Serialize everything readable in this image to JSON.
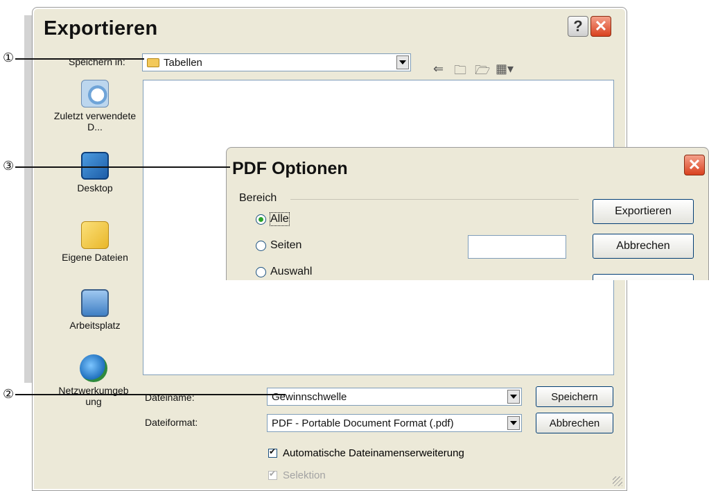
{
  "callouts": [
    "①",
    "②",
    "③"
  ],
  "export_dialog": {
    "title": "Exportieren",
    "help_glyph": "?",
    "close_glyph": "✕",
    "save_in_label": "Speichern in:",
    "save_in_value": "Tabellen",
    "toolbar_icons": [
      "back-icon",
      "up-folder-icon",
      "new-folder-icon",
      "view-menu-icon"
    ],
    "sidebar": [
      {
        "label": "Zuletzt verwendete D...",
        "icon": "recent-documents-icon"
      },
      {
        "label": "Desktop",
        "icon": "desktop-icon"
      },
      {
        "label": "Eigene Dateien",
        "icon": "my-documents-icon"
      },
      {
        "label": "Arbeitsplatz",
        "icon": "my-computer-icon"
      },
      {
        "label": "Netzwerkumgeb ung",
        "icon": "network-places-icon"
      }
    ],
    "filename_label": "Dateiname:",
    "filename_value": "Gewinnschwelle",
    "format_label": "Dateiformat:",
    "format_value": "PDF - Portable Document Format (.pdf)",
    "save_button": "Speichern",
    "cancel_button": "Abbrechen",
    "auto_extension_label": "Automatische Dateinamenserweiterung",
    "selection_label": "Selektion"
  },
  "pdf_dialog": {
    "title": "PDF Optionen",
    "close_glyph": "✕",
    "range_label": "Bereich",
    "radio_all": "Alle",
    "radio_pages": "Seiten",
    "radio_selection": "Auswahl",
    "export_button": "Exportieren",
    "cancel_button": "Abbrechen"
  }
}
